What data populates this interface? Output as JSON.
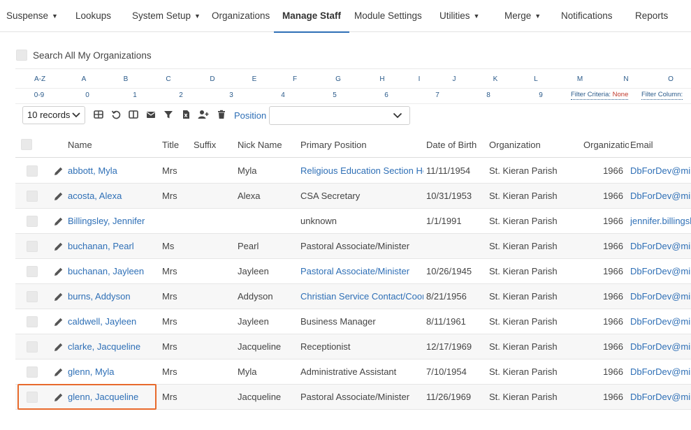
{
  "nav": [
    {
      "label": "Suspense",
      "caret": true
    },
    {
      "label": "Lookups",
      "caret": false
    },
    {
      "label": "System Setup",
      "caret": true
    },
    {
      "label": "Organizations",
      "caret": false
    },
    {
      "label": "Manage Staff",
      "caret": false,
      "active": true
    },
    {
      "label": "Module Settings",
      "caret": false
    },
    {
      "label": "Utilities",
      "caret": true
    },
    {
      "label": "Merge",
      "caret": true
    },
    {
      "label": "Notifications",
      "caret": false
    },
    {
      "label": "Reports",
      "caret": false
    }
  ],
  "search_all_label": "Search All My Organizations",
  "letters_row1": [
    "A-Z",
    "A",
    "B",
    "C",
    "D",
    "E",
    "F",
    "G",
    "H",
    "I",
    "J",
    "K",
    "L",
    "M",
    "N",
    "O"
  ],
  "letters_row2": [
    "0-9",
    "0",
    "1",
    "2",
    "3",
    "4",
    "5",
    "6",
    "7",
    "8",
    "9"
  ],
  "filter": {
    "criteria_label": "Filter Criteria:",
    "criteria_value": "None",
    "column_label": "Filter Column:"
  },
  "toolbar": {
    "records": "10 records",
    "position_label": "Position",
    "position_value": ""
  },
  "columns": {
    "name": "Name",
    "title": "Title",
    "suffix": "Suffix",
    "nick": "Nick Name",
    "position": "Primary Position",
    "dob": "Date of Birth",
    "org": "Organization",
    "orgid": "Organization ID",
    "email": "Email"
  },
  "rows": [
    {
      "name": "abbott, Myla",
      "title": "Mrs",
      "suffix": "",
      "nick": "Myla",
      "position": "Religious Education Section Head",
      "position_link": true,
      "dob": "11/11/1954",
      "org": "St. Kieran Parish",
      "orgid": "1966",
      "email": "DbForDev@ministrybrands.com"
    },
    {
      "name": "acosta, Alexa",
      "title": "Mrs",
      "suffix": "",
      "nick": "Alexa",
      "position": "CSA Secretary",
      "position_link": false,
      "dob": "10/31/1953",
      "org": "St. Kieran Parish",
      "orgid": "1966",
      "email": "DbForDev@ministrybrands.com"
    },
    {
      "name": "Billingsley, Jennifer",
      "title": "",
      "suffix": "",
      "nick": "",
      "position": "unknown",
      "position_link": false,
      "dob": "1/1/1991",
      "org": "St. Kieran Parish",
      "orgid": "1966",
      "email": "jennifer.billingsley@example.com"
    },
    {
      "name": "buchanan, Pearl",
      "title": "Ms",
      "suffix": "",
      "nick": "Pearl",
      "position": "Pastoral Associate/Minister",
      "position_link": false,
      "dob": "",
      "org": "St. Kieran Parish",
      "orgid": "1966",
      "email": "DbForDev@ministrybrands.com"
    },
    {
      "name": "buchanan, Jayleen",
      "title": "Mrs",
      "suffix": "",
      "nick": "Jayleen",
      "position": "Pastoral Associate/Minister",
      "position_link": true,
      "dob": "10/26/1945",
      "org": "St. Kieran Parish",
      "orgid": "1966",
      "email": "DbForDev@ministrybrands.com"
    },
    {
      "name": "burns, Addyson",
      "title": "Mrs",
      "suffix": "",
      "nick": "Addyson",
      "position": "Christian Service Contact/Coordinator",
      "position_link": true,
      "dob": "8/21/1956",
      "org": "St. Kieran Parish",
      "orgid": "1966",
      "email": "DbForDev@ministrybrands.com"
    },
    {
      "name": "caldwell, Jayleen",
      "title": "Mrs",
      "suffix": "",
      "nick": "Jayleen",
      "position": "Business Manager",
      "position_link": false,
      "dob": "8/11/1961",
      "org": "St. Kieran Parish",
      "orgid": "1966",
      "email": "DbForDev@ministrybrands.com"
    },
    {
      "name": "clarke, Jacqueline",
      "title": "Mrs",
      "suffix": "",
      "nick": "Jacqueline",
      "position": "Receptionist",
      "position_link": false,
      "dob": "12/17/1969",
      "org": "St. Kieran Parish",
      "orgid": "1966",
      "email": "DbForDev@ministrybrands.com"
    },
    {
      "name": "glenn, Myla",
      "title": "Mrs",
      "suffix": "",
      "nick": "Myla",
      "position": "Administrative Assistant",
      "position_link": false,
      "dob": "7/10/1954",
      "org": "St. Kieran Parish",
      "orgid": "1966",
      "email": "DbForDev@ministrybrands.com"
    },
    {
      "name": "glenn, Jacqueline",
      "title": "Mrs",
      "suffix": "",
      "nick": "Jacqueline",
      "position": "Pastoral Associate/Minister",
      "position_link": false,
      "dob": "11/26/1969",
      "org": "St. Kieran Parish",
      "orgid": "1966",
      "email": "DbForDev@ministrybrands.com"
    }
  ],
  "colors": {
    "link": "#2e6fb6",
    "highlight": "#e86a2c",
    "accent": "#2e6fb6"
  }
}
